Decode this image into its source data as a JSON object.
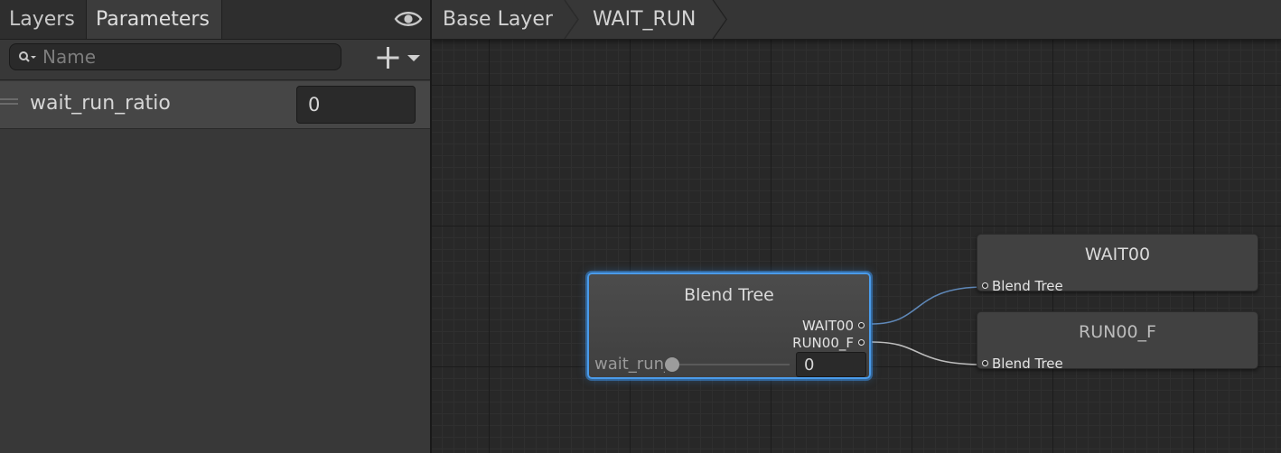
{
  "left_panel": {
    "tabs": [
      {
        "label": "Layers",
        "active": false
      },
      {
        "label": "Parameters",
        "active": true
      }
    ],
    "visibility_icon": "eye-icon",
    "search": {
      "placeholder": "Name",
      "value": "",
      "icon": "search-icon"
    },
    "add_button_icon": "plus-dropdown-icon",
    "parameters": [
      {
        "name": "wait_run_ratio",
        "value": "0"
      }
    ]
  },
  "graph": {
    "breadcrumb": [
      "Base Layer",
      "WAIT_RUN"
    ],
    "nodes": {
      "blend_tree": {
        "title": "Blend Tree",
        "outputs": [
          "WAIT00",
          "RUN00_F"
        ],
        "parameter_label": "wait_run_ratio",
        "parameter_slider_level": 0,
        "parameter_value": "0",
        "selected": true
      },
      "wait00": {
        "title": "WAIT00",
        "input_label": "Blend Tree"
      },
      "run00_f": {
        "title": "RUN00_F",
        "input_label": "Blend Tree"
      }
    }
  },
  "colors": {
    "selection_outline": "#4a9bea",
    "connection_line": "#bdbdbd",
    "panel_bg": "#383838",
    "graph_bg": "#282828"
  }
}
